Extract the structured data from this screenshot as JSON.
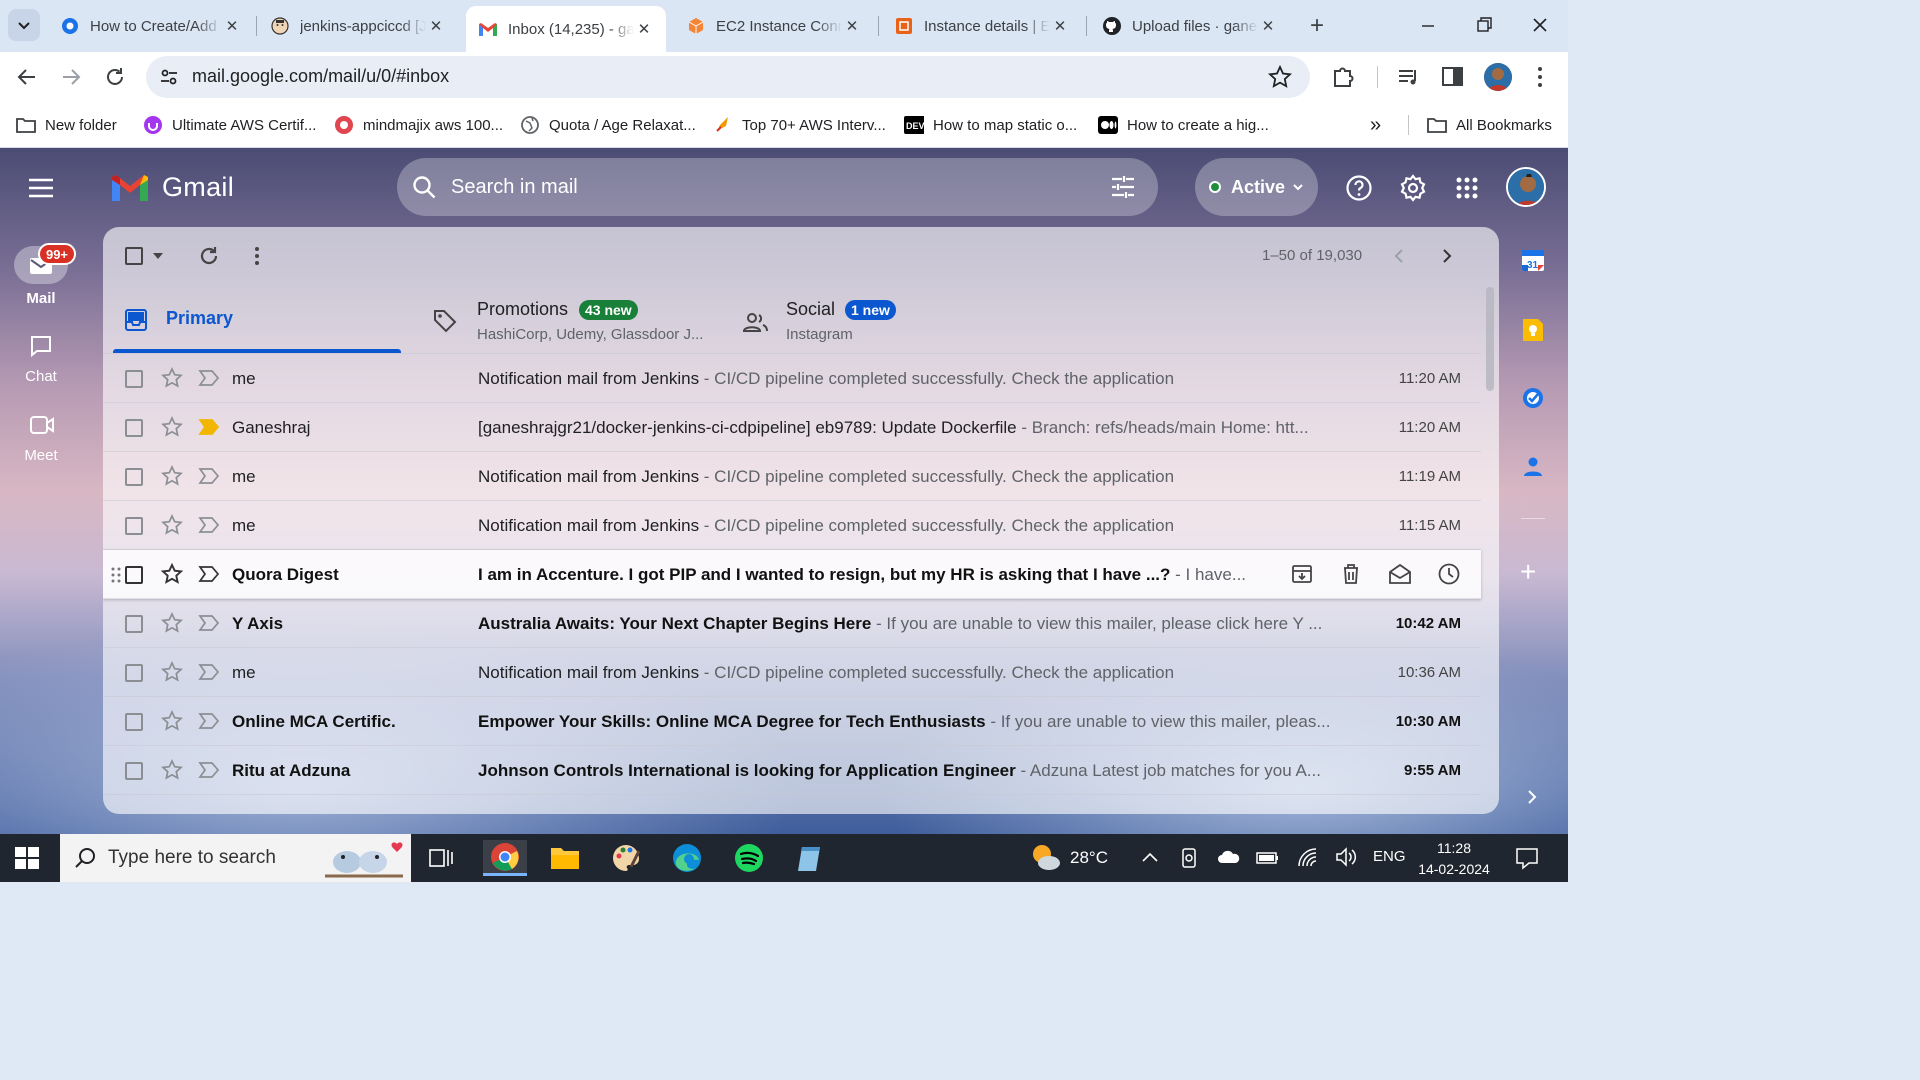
{
  "browser": {
    "tabs": [
      {
        "title": "How to Create/Add",
        "icon": "generic-site-icon",
        "active": false
      },
      {
        "title": "jenkins-appciccd [J",
        "icon": "jenkins-icon",
        "active": false
      },
      {
        "title": "Inbox (14,235) - ga",
        "icon": "gmail-icon",
        "active": true
      },
      {
        "title": "EC2 Instance Conn",
        "icon": "aws-cube-icon",
        "active": false
      },
      {
        "title": "Instance details | E",
        "icon": "aws-console-icon",
        "active": false
      },
      {
        "title": "Upload files · gane",
        "icon": "github-icon",
        "active": false
      }
    ],
    "url": "mail.google.com/mail/u/0/#inbox",
    "bookmarks": [
      {
        "label": "New folder",
        "icon": "folder-icon"
      },
      {
        "label": "Ultimate AWS Certif...",
        "icon": "udemy-icon"
      },
      {
        "label": "mindmajix aws 100...",
        "icon": "mindmajix-icon"
      },
      {
        "label": "Quota / Age Relaxat...",
        "icon": "globe-icon"
      },
      {
        "label": "Top 70+ AWS Interv...",
        "icon": "rocket-icon"
      },
      {
        "label": "How to map static o...",
        "icon": "dev-icon"
      },
      {
        "label": "How to create a hig...",
        "icon": "medium-icon"
      }
    ],
    "bookmarks_more": "»",
    "all_bookmarks": "All Bookmarks"
  },
  "gmail": {
    "logo_text": "Gmail",
    "search_placeholder": "Search in mail",
    "status": "Active",
    "nav": [
      {
        "label": "Mail",
        "badge": "99+"
      },
      {
        "label": "Chat"
      },
      {
        "label": "Meet"
      }
    ],
    "pagination": "1–50 of 19,030",
    "tabs": {
      "primary": "Primary",
      "promotions": {
        "label": "Promotions",
        "badge": "43 new",
        "sub": "HashiCorp, Udemy, Glassdoor J..."
      },
      "social": {
        "label": "Social",
        "badge": "1 new",
        "sub": "Instagram"
      }
    },
    "emails": [
      {
        "sender": "me",
        "subject": "Notification mail from Jenkins",
        "snippet": " - CI/CD pipeline completed successfully. Check the application",
        "time": "11:20 AM",
        "unread": false,
        "important": false
      },
      {
        "sender": "Ganeshraj",
        "subject": "[ganeshrajgr21/docker-jenkins-ci-cdpipeline] eb9789: Update Dockerfile",
        "snippet": " - Branch: refs/heads/main Home: htt...",
        "time": "11:20 AM",
        "unread": false,
        "important": true
      },
      {
        "sender": "me",
        "subject": "Notification mail from Jenkins",
        "snippet": " - CI/CD pipeline completed successfully. Check the application",
        "time": "11:19 AM",
        "unread": false,
        "important": false
      },
      {
        "sender": "me",
        "subject": "Notification mail from Jenkins",
        "snippet": " - CI/CD pipeline completed successfully. Check the application",
        "time": "11:15 AM",
        "unread": false,
        "important": false
      },
      {
        "sender": "Quora Digest",
        "subject": "I am in Accenture. I got PIP and I wanted to resign, but my HR is asking that I have ...?",
        "snippet": " - I have...",
        "time": "",
        "unread": true,
        "important": false,
        "hover": true
      },
      {
        "sender": "Y Axis",
        "subject": "Australia Awaits: Your Next Chapter Begins Here",
        "snippet": " - If you are unable to view this mailer, please click here Y ...",
        "time": "10:42 AM",
        "unread": true,
        "important": false
      },
      {
        "sender": "me",
        "subject": "Notification mail from Jenkins",
        "snippet": " - CI/CD pipeline completed successfully. Check the application",
        "time": "10:36 AM",
        "unread": false,
        "important": false
      },
      {
        "sender": "Online MCA Certific.",
        "subject": "Empower Your Skills: Online MCA Degree for Tech Enthusiasts",
        "snippet": " - If you are unable to view this mailer, pleas...",
        "time": "10:30 AM",
        "unread": true,
        "important": false
      },
      {
        "sender": "Ritu at Adzuna",
        "subject": "Johnson Controls International is looking for Application Engineer",
        "snippet": " - Adzuna Latest job matches for you A...",
        "time": "9:55 AM",
        "unread": true,
        "important": false
      }
    ]
  },
  "taskbar": {
    "search_placeholder": "Type here to search",
    "weather": "28°C",
    "lang": "ENG",
    "time": "11:28",
    "date": "14-02-2024"
  },
  "colors": {
    "accent": "#0b57d0",
    "primary_underline": "#0b57d0",
    "badge_green": "#188038",
    "badge_blue": "#0b57d0",
    "active_dot": "#1e8e3e",
    "important": "#f2b600"
  }
}
